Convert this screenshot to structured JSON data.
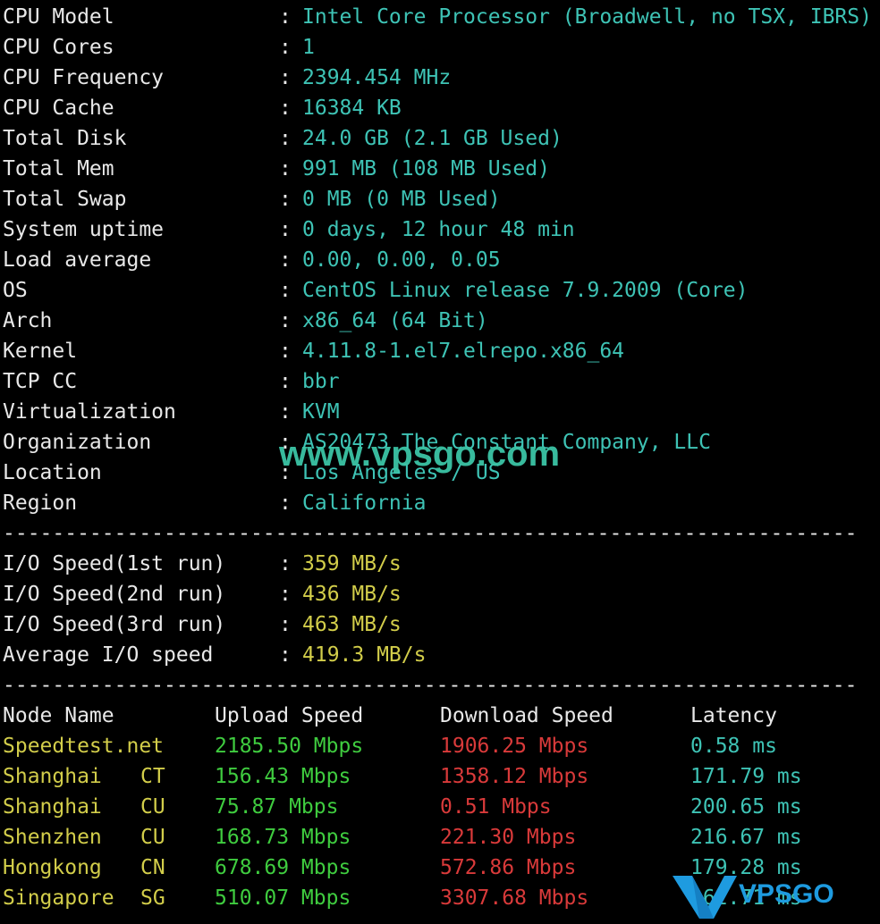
{
  "system_info": [
    {
      "label": "CPU Model",
      "value": "Intel Core Processor (Broadwell, no TSX, IBRS)"
    },
    {
      "label": "CPU Cores",
      "value": "1"
    },
    {
      "label": "CPU Frequency",
      "value": "2394.454 MHz"
    },
    {
      "label": "CPU Cache",
      "value": "16384 KB"
    },
    {
      "label": "Total Disk",
      "value": "24.0 GB (2.1 GB Used)"
    },
    {
      "label": "Total Mem",
      "value": "991 MB (108 MB Used)"
    },
    {
      "label": "Total Swap",
      "value": "0 MB (0 MB Used)"
    },
    {
      "label": "System uptime",
      "value": "0 days, 12 hour 48 min"
    },
    {
      "label": "Load average",
      "value": "0.00, 0.00, 0.05"
    },
    {
      "label": "OS",
      "value": "CentOS Linux release 7.9.2009 (Core)"
    },
    {
      "label": "Arch",
      "value": "x86_64 (64 Bit)"
    },
    {
      "label": "Kernel",
      "value": "4.11.8-1.el7.elrepo.x86_64"
    },
    {
      "label": "TCP CC",
      "value": "bbr"
    },
    {
      "label": "Virtualization",
      "value": "KVM"
    },
    {
      "label": "Organization",
      "value": "AS20473 The Constant Company, LLC"
    },
    {
      "label": "Location",
      "value": "Los Angeles / US"
    },
    {
      "label": "Region",
      "value": "California"
    }
  ],
  "separator": ":",
  "divider": "---------------------------------------------------------------------",
  "io": [
    {
      "label": "I/O Speed(1st run)",
      "value": "359 MB/s"
    },
    {
      "label": "I/O Speed(2nd run)",
      "value": "436 MB/s"
    },
    {
      "label": "I/O Speed(3rd run)",
      "value": "463 MB/s"
    },
    {
      "label": "Average I/O speed",
      "value": "419.3 MB/s"
    }
  ],
  "speed_table": {
    "headers": [
      "Node Name",
      "Upload Speed",
      "Download Speed",
      "Latency"
    ],
    "rows": [
      {
        "node": "Speedtest.net",
        "code": "",
        "upload": "2185.50 Mbps",
        "download": "1906.25 Mbps",
        "latency": "0.58 ms"
      },
      {
        "node": "Shanghai",
        "code": "CT",
        "upload": "156.43 Mbps",
        "download": "1358.12 Mbps",
        "latency": "171.79 ms"
      },
      {
        "node": "Shanghai",
        "code": "CU",
        "upload": "75.87 Mbps",
        "download": "0.51 Mbps",
        "latency": "200.65 ms"
      },
      {
        "node": "Shenzhen",
        "code": "CU",
        "upload": "168.73 Mbps",
        "download": "221.30 Mbps",
        "latency": "216.67 ms"
      },
      {
        "node": "Hongkong",
        "code": "CN",
        "upload": "678.69 Mbps",
        "download": "572.86 Mbps",
        "latency": "179.28 ms"
      },
      {
        "node": "Singapore",
        "code": "SG",
        "upload": "510.07 Mbps",
        "download": "3307.68 Mbps",
        "latency": "162.71 ms"
      }
    ]
  },
  "watermark": "www.vpsgo.com",
  "logo_text": "VPSGO",
  "colors": {
    "background": "#000000",
    "label": "#e8e8e8",
    "info_value": "#3ec3b5",
    "io_value": "#d2cd4a",
    "node": "#d2cd4a",
    "upload": "#3fcc3f",
    "download": "#d93a3a",
    "latency": "#3ec3b5",
    "logo": "#1e9be0"
  }
}
